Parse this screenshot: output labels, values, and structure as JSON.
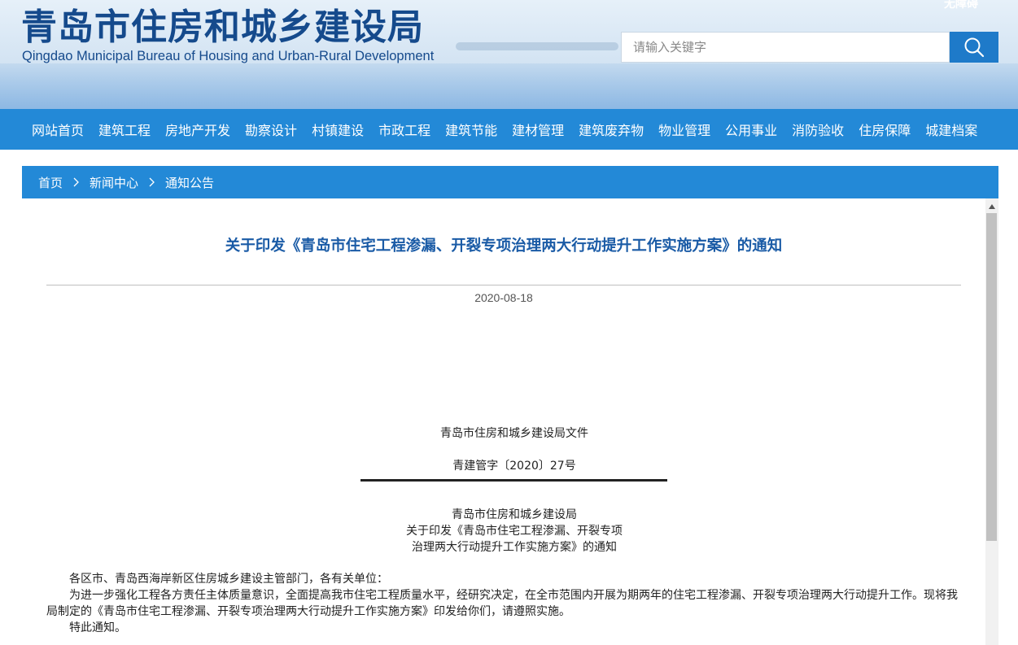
{
  "header": {
    "title_cn": "青岛市住房和城乡建设局",
    "title_en": "Qingdao Municipal Bureau of Housing and Urban-Rural Development",
    "access_link": "无障碍",
    "search": {
      "placeholder": "请输入关键字"
    }
  },
  "nav": {
    "items": [
      {
        "label": "网站首页"
      },
      {
        "label": "建筑工程"
      },
      {
        "label": "房地产开发"
      },
      {
        "label": "勘察设计"
      },
      {
        "label": "村镇建设"
      },
      {
        "label": "市政工程"
      },
      {
        "label": "建筑节能"
      },
      {
        "label": "建材管理"
      },
      {
        "label": "建筑废弃物"
      },
      {
        "label": "物业管理"
      },
      {
        "label": "公用事业"
      },
      {
        "label": "消防验收"
      },
      {
        "label": "住房保障"
      },
      {
        "label": "城建档案"
      }
    ]
  },
  "breadcrumb": {
    "items": [
      {
        "label": "首页"
      },
      {
        "label": "新闻中心"
      },
      {
        "label": "通知公告"
      }
    ]
  },
  "article": {
    "title": "关于印发《青岛市住宅工程渗漏、开裂专项治理两大行动提升工作实施方案》的通知",
    "date": "2020-08-18",
    "doc_header": "青岛市住房和城乡建设局文件",
    "doc_number": "青建管字〔2020〕27号",
    "issuer": "青岛市住房和城乡建设局",
    "heading_line1": "关于印发《青岛市住宅工程渗漏、开裂专项",
    "heading_line2": "治理两大行动提升工作实施方案》的通知",
    "salutation": "各区市、青岛西海岸新区住房城乡建设主管部门，各有关单位：",
    "body": "为进一步强化工程各方责任主体质量意识，全面提高我市住宅工程质量水平，经研究决定，在全市范围内开展为期两年的住宅工程渗漏、开裂专项治理两大行动提升工作。现将我局制定的《青岛市住宅工程渗漏、开裂专项治理两大行动提升工作实施方案》印发给你们，请遵照实施。",
    "closing": "特此通知。"
  },
  "colors": {
    "nav_bg": "#2389d7",
    "title": "#1a5ba6",
    "logo": "#154a8c",
    "search_button": "#1e7ac9"
  }
}
